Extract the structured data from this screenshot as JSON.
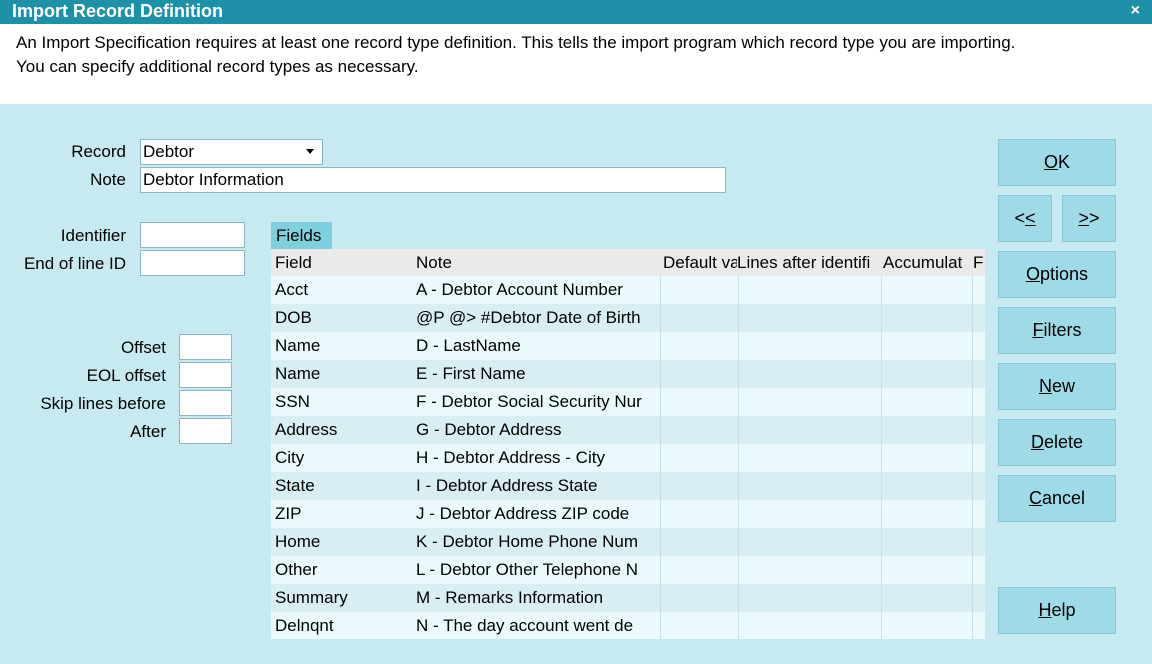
{
  "window": {
    "title": "Import Record Definition",
    "close_glyph": "×"
  },
  "description": {
    "line1": "An Import Specification requires at least one record type definition. This tells the import program which record type you are importing.",
    "line2": "You can specify additional record types as necessary."
  },
  "form": {
    "record_label": "Record",
    "record_value": "Debtor",
    "note_label": "Note",
    "note_value": "Debtor Information",
    "identifier_label": "Identifier",
    "identifier_value": "",
    "eol_id_label": "End of line ID",
    "eol_id_value": "",
    "offset_label": "Offset",
    "eol_offset_label": "EOL offset",
    "skip_before_label": "Skip lines before",
    "after_label": "After"
  },
  "fields_tab": {
    "label": "Fields"
  },
  "grid": {
    "columns": [
      "Field",
      "Note",
      "Default va",
      "Lines after identifi",
      "Accumulat",
      "F"
    ],
    "rows": [
      {
        "field": "Acct",
        "note": "A - Debtor Account Number"
      },
      {
        "field": "DOB",
        "note": "@P @> #Debtor Date of Birth"
      },
      {
        "field": "Name",
        "note": "D - LastName"
      },
      {
        "field": "Name",
        "note": "E - First Name"
      },
      {
        "field": "SSN",
        "note": "F - Debtor Social Security Nur"
      },
      {
        "field": "Address",
        "note": "G  - Debtor Address"
      },
      {
        "field": "City",
        "note": "H - Debtor Address - City"
      },
      {
        "field": "State",
        "note": "I - Debtor Address State"
      },
      {
        "field": "ZIP",
        "note": "J - Debtor Address ZIP code"
      },
      {
        "field": "Home",
        "note": "K - Debtor Home Phone Num"
      },
      {
        "field": "Other",
        "note": "L - Debtor Other Telephone N"
      },
      {
        "field": "Summary",
        "note": "M - Remarks Information"
      },
      {
        "field": "Delnqnt",
        "note": "N - The day account went de"
      }
    ]
  },
  "buttons": {
    "ok": {
      "pre": "",
      "u": "O",
      "post": "K"
    },
    "prev": {
      "pre": "<",
      "u": "<",
      "post": ""
    },
    "next": {
      "pre": "",
      "u": ">",
      "post": ">"
    },
    "options": {
      "pre": "",
      "u": "O",
      "post": "ptions"
    },
    "filters": {
      "pre": "",
      "u": "F",
      "post": "ilters"
    },
    "new": {
      "pre": "",
      "u": "N",
      "post": "ew"
    },
    "delete": {
      "pre": "",
      "u": "D",
      "post": "elete"
    },
    "cancel": {
      "pre": "",
      "u": "C",
      "post": "ancel"
    },
    "help": {
      "pre": "",
      "u": "H",
      "post": "elp"
    }
  }
}
